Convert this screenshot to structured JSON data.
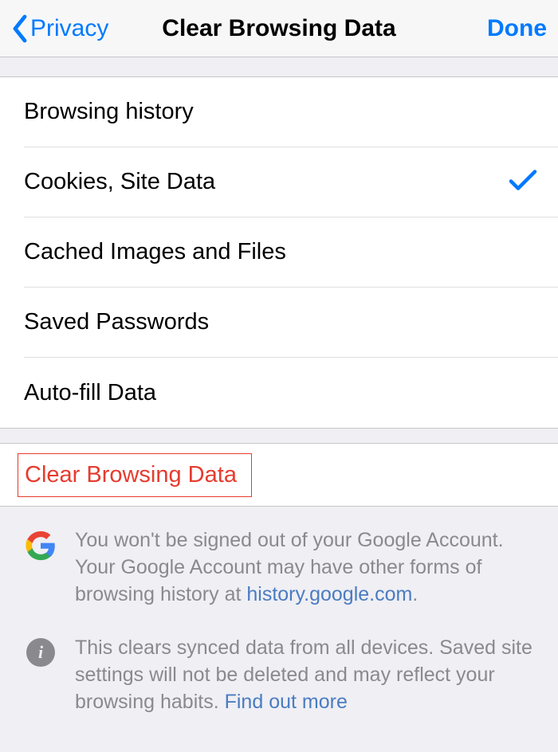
{
  "navbar": {
    "back_label": "Privacy",
    "title": "Clear Browsing Data",
    "done_label": "Done"
  },
  "items": [
    {
      "label": "Browsing history",
      "checked": false
    },
    {
      "label": "Cookies, Site Data",
      "checked": true
    },
    {
      "label": "Cached Images and Files",
      "checked": false
    },
    {
      "label": "Saved Passwords",
      "checked": false
    },
    {
      "label": "Auto-fill Data",
      "checked": false
    }
  ],
  "action": {
    "clear_label": "Clear Browsing Data"
  },
  "footer": {
    "google_text": "You won't be signed out of your Google Account. Your Google Account may have other forms of browsing history at ",
    "google_link": "history.google.com",
    "google_text_end": ".",
    "info_text": "This clears synced data from all devices. Saved site settings will not be deleted and may reflect your browsing habits. ",
    "info_link": "Find out more"
  }
}
